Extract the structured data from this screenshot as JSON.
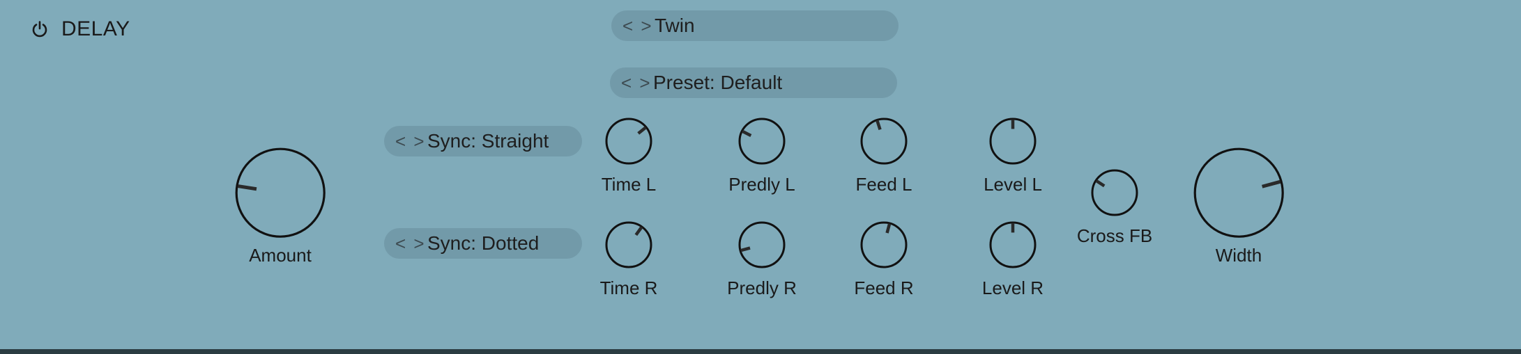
{
  "panel": {
    "title": "DELAY",
    "power_icon": "power-icon"
  },
  "selectors": {
    "mode": "Twin",
    "preset": "Preset: Default",
    "sync_left": "Sync: Straight",
    "sync_right": "Sync: Dotted",
    "arrows_glyph": "< >"
  },
  "knobs": {
    "amount": {
      "label": "Amount",
      "value": 0.23
    },
    "time_l": {
      "label": "Time L",
      "value": 0.67
    },
    "time_r": {
      "label": "Time R",
      "value": 0.62
    },
    "predly_l": {
      "label": "Predly L",
      "value": 0.29
    },
    "predly_r": {
      "label": "Predly R",
      "value": 0.15
    },
    "feed_l": {
      "label": "Feed L",
      "value": 0.44
    },
    "feed_r": {
      "label": "Feed R",
      "value": 0.55
    },
    "level_l": {
      "label": "Level L",
      "value": 0.5
    },
    "level_r": {
      "label": "Level R",
      "value": 0.5
    },
    "cross_fb": {
      "label": "Cross FB",
      "value": 0.31
    },
    "width": {
      "label": "Width",
      "value": 0.75
    }
  },
  "colors": {
    "background": "#80abba",
    "knob_stroke": "#111111",
    "indicator": "#2a2a2a"
  }
}
